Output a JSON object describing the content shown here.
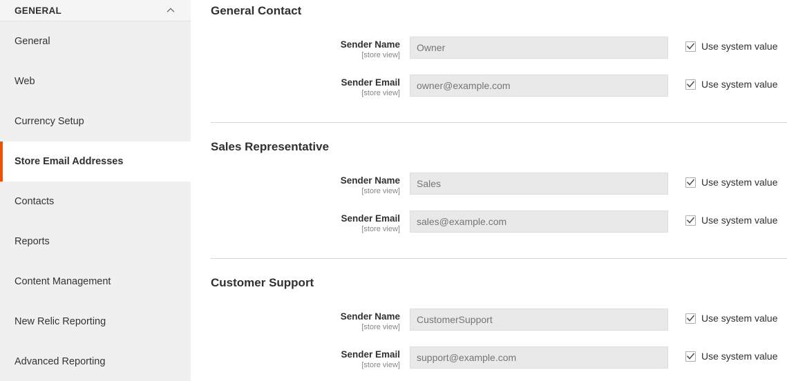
{
  "sidebar": {
    "header": {
      "title": "GENERAL",
      "collapse_icon": "chevron-up-icon"
    },
    "items": [
      {
        "label": "General",
        "active": false
      },
      {
        "label": "Web",
        "active": false
      },
      {
        "label": "Currency Setup",
        "active": false
      },
      {
        "label": "Store Email Addresses",
        "active": true
      },
      {
        "label": "Contacts",
        "active": false
      },
      {
        "label": "Reports",
        "active": false
      },
      {
        "label": "Content Management",
        "active": false
      },
      {
        "label": "New Relic Reporting",
        "active": false
      },
      {
        "label": "Advanced Reporting",
        "active": false
      }
    ],
    "active_accent_color": "#eb5202"
  },
  "main": {
    "sections": [
      {
        "title": "General Contact",
        "has_top_divider": false,
        "fields": [
          {
            "label": "Sender Name",
            "scope": "[store view]",
            "value": "Owner",
            "placeholder": "Owner",
            "system_value_label": "Use system value",
            "system_value_checked": true,
            "disabled": true
          },
          {
            "label": "Sender Email",
            "scope": "[store view]",
            "value": "owner@example.com",
            "placeholder": "owner@example.com",
            "system_value_label": "Use system value",
            "system_value_checked": true,
            "disabled": true
          }
        ]
      },
      {
        "title": "Sales Representative",
        "has_top_divider": true,
        "fields": [
          {
            "label": "Sender Name",
            "scope": "[store view]",
            "value": "Sales",
            "placeholder": "Sales",
            "system_value_label": "Use system value",
            "system_value_checked": true,
            "disabled": true
          },
          {
            "label": "Sender Email",
            "scope": "[store view]",
            "value": "sales@example.com",
            "placeholder": "sales@example.com",
            "system_value_label": "Use system value",
            "system_value_checked": true,
            "disabled": true
          }
        ]
      },
      {
        "title": "Customer Support",
        "has_top_divider": true,
        "fields": [
          {
            "label": "Sender Name",
            "scope": "[store view]",
            "value": "CustomerSupport",
            "placeholder": "CustomerSupport",
            "system_value_label": "Use system value",
            "system_value_checked": true,
            "disabled": true
          },
          {
            "label": "Sender Email",
            "scope": "[store view]",
            "value": "support@example.com",
            "placeholder": "support@example.com",
            "system_value_label": "Use system value",
            "system_value_checked": true,
            "disabled": true
          }
        ]
      }
    ]
  }
}
